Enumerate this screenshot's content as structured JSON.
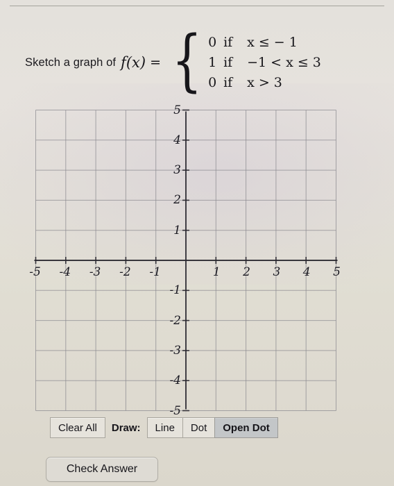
{
  "problem": {
    "prompt": "Sketch a graph of",
    "function_name": "f(x)",
    "equals": "=",
    "brace": "{",
    "cases": [
      {
        "value": "0",
        "if": "if",
        "condition": "x ≤ − 1",
        "var": "x"
      },
      {
        "value": "1",
        "if": "if",
        "condition": "−1 < x ≤ 3",
        "var": "x"
      },
      {
        "value": "0",
        "if": "if",
        "condition": "x > 3",
        "var": "x"
      }
    ]
  },
  "chart_data": {
    "type": "line",
    "title": "",
    "xlabel": "",
    "ylabel": "",
    "xlim": [
      -5,
      5
    ],
    "ylim": [
      -5,
      5
    ],
    "grid": true,
    "legend": "none",
    "x_ticks": [
      "-5",
      "-4",
      "-3",
      "-2",
      "-1",
      "1",
      "2",
      "3",
      "4",
      "5"
    ],
    "x_tick_values": [
      -5,
      -4,
      -3,
      -2,
      -1,
      1,
      2,
      3,
      4,
      5
    ],
    "y_ticks": [
      "5",
      "4",
      "3",
      "2",
      "1",
      "-1",
      "-2",
      "-3",
      "-4",
      "-5"
    ],
    "y_tick_values": [
      5,
      4,
      3,
      2,
      1,
      -1,
      -2,
      -3,
      -4,
      -5
    ],
    "series": [],
    "note": "empty sketch grid; no user-drawn curve present"
  },
  "toolbar": {
    "clear_all": "Clear All",
    "draw_label": "Draw:",
    "modes": [
      {
        "label": "Line",
        "selected": false
      },
      {
        "label": "Dot",
        "selected": false
      },
      {
        "label": "Open Dot",
        "selected": true
      }
    ]
  },
  "check_answer": "Check Answer",
  "colors": {
    "page_bg": "#e2dfd7",
    "grid_line": "#8b8a90",
    "axis_line": "#2a2830",
    "text": "#17161a",
    "button_bg": "#e6e3dc",
    "button_selected_bg": "#c3c6c8",
    "button_border": "#a8a59d"
  }
}
